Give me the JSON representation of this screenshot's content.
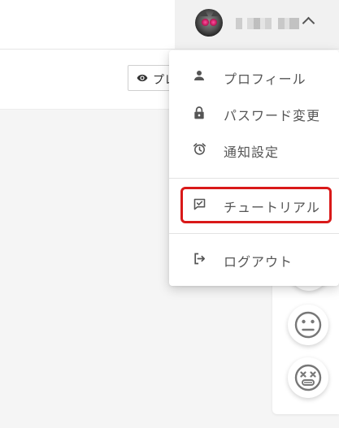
{
  "header": {
    "user_menu": {
      "avatar_alt": "user avatar",
      "name_blurred": true
    }
  },
  "toolbar": {
    "preview_label": "プレ"
  },
  "user_menu": {
    "items": [
      {
        "label": "プロフィール",
        "icon": "person-icon"
      },
      {
        "label": "パスワード変更",
        "icon": "lock-icon"
      },
      {
        "label": "通知設定",
        "icon": "alarm-clock-icon"
      },
      {
        "label": "チュートリアル",
        "icon": "chat-check-icon",
        "highlighted": true
      },
      {
        "label": "ログアウト",
        "icon": "logout-icon"
      }
    ]
  },
  "feedback": {
    "faces": [
      "neutral-face-icon",
      "dizzy-face-icon"
    ]
  },
  "colors": {
    "highlight_border": "#d91919",
    "menu_text": "#555555",
    "header_user_bg": "#f1f1f1",
    "content_bg": "#f5f5f5"
  }
}
